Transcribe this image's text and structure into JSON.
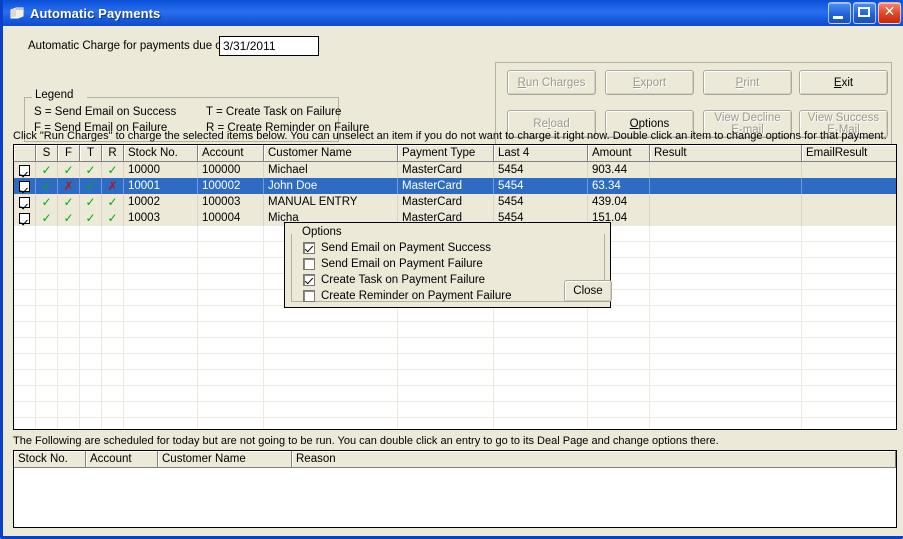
{
  "window": {
    "title": "Automatic Payments",
    "icon": "form-window-icon",
    "minimize_label": "Minimize",
    "maximize_label": "Maximize",
    "close_label": "✕",
    "titlebar_color": "#1157DE",
    "face_color": "#ECE9D8"
  },
  "header": {
    "date_label": "Automatic Charge for payments due on:",
    "date_value": "3/31/2011",
    "date_placeholder": "m/d/yyyy"
  },
  "legend": {
    "title": "Legend",
    "lines": [
      {
        "left": "S = Send Email on Success",
        "right": "T = Create Task on Failure"
      },
      {
        "left": "F = Send Email on Failure",
        "right": "R = Create Reminder on Failure"
      }
    ]
  },
  "toolbar": {
    "buttons": [
      {
        "name": "run-charges",
        "label": "Run Charges",
        "accel": "R",
        "enabled": false
      },
      {
        "name": "export",
        "label": "Export",
        "accel": "E",
        "enabled": false
      },
      {
        "name": "print",
        "label": "Print",
        "accel": "P",
        "enabled": false
      },
      {
        "name": "exit",
        "label": "Exit",
        "accel": "E",
        "enabled": true
      },
      {
        "name": "reload",
        "label": "Reload",
        "accel": "l",
        "enabled": false
      },
      {
        "name": "options",
        "label": "Options",
        "accel": "O",
        "enabled": true
      },
      {
        "name": "view-decline-email",
        "label": "View Decline E-mail",
        "accel": "",
        "enabled": false
      },
      {
        "name": "view-success-email",
        "label": "View Success E-Mail",
        "accel": "",
        "enabled": false
      }
    ]
  },
  "main_grid": {
    "instruction": "Click \"Run Charges\" to charge the selected items below. You can unselect an item if you do not want to charge it right now. Double click an item to change options for that payment.",
    "columns": [
      "",
      "S",
      "F",
      "T",
      "R",
      "Stock No.",
      "Account",
      "Customer Name",
      "Payment Type",
      "Last 4",
      "Amount",
      "Result",
      "EmailResult"
    ],
    "rows": [
      {
        "selected_checkbox": true,
        "s": "check",
        "f": "check",
        "t": "check",
        "r": "check",
        "stock_no": "10000",
        "account": "100000",
        "customer_name": "Michael",
        "payment_type": "MasterCard",
        "last4": "5454",
        "amount": "903.44",
        "result": "",
        "email_result": "",
        "highlighted": false
      },
      {
        "selected_checkbox": true,
        "s": "check",
        "f": "cross",
        "t": "check",
        "r": "cross",
        "stock_no": "10001",
        "account": "100002",
        "customer_name": "John Doe",
        "payment_type": "MasterCard",
        "last4": "5454",
        "amount": "63.34",
        "result": "",
        "email_result": "",
        "highlighted": true
      },
      {
        "selected_checkbox": true,
        "s": "check",
        "f": "check",
        "t": "check",
        "r": "check",
        "stock_no": "10002",
        "account": "100003",
        "customer_name": "MANUAL ENTRY",
        "payment_type": "MasterCard",
        "last4": "5454",
        "amount": "439.04",
        "result": "",
        "email_result": "",
        "highlighted": false
      },
      {
        "selected_checkbox": true,
        "s": "check",
        "f": "check",
        "t": "check",
        "r": "check",
        "stock_no": "10003",
        "account": "100004",
        "customer_name": "Micha",
        "payment_type": "MasterCard",
        "last4": "5454",
        "amount": "151.04",
        "result": "",
        "email_result": "",
        "highlighted": false
      }
    ]
  },
  "options_dialog": {
    "title": "Options",
    "items": [
      {
        "label": "Send Email on Payment Success",
        "checked": true
      },
      {
        "label": "Send Email on Payment Failure",
        "checked": false
      },
      {
        "label": "Create Task on Payment Failure",
        "checked": true
      },
      {
        "label": "Create Reminder on Payment Failure",
        "checked": false
      }
    ],
    "close_label": "Close"
  },
  "bottom_grid": {
    "instruction": "The Following are scheduled for today but are not going to be run. You can double click an entry to go to its Deal Page and change options there.",
    "columns": [
      "Stock No.",
      "Account",
      "Customer Name",
      "Reason",
      ""
    ],
    "rows": []
  }
}
